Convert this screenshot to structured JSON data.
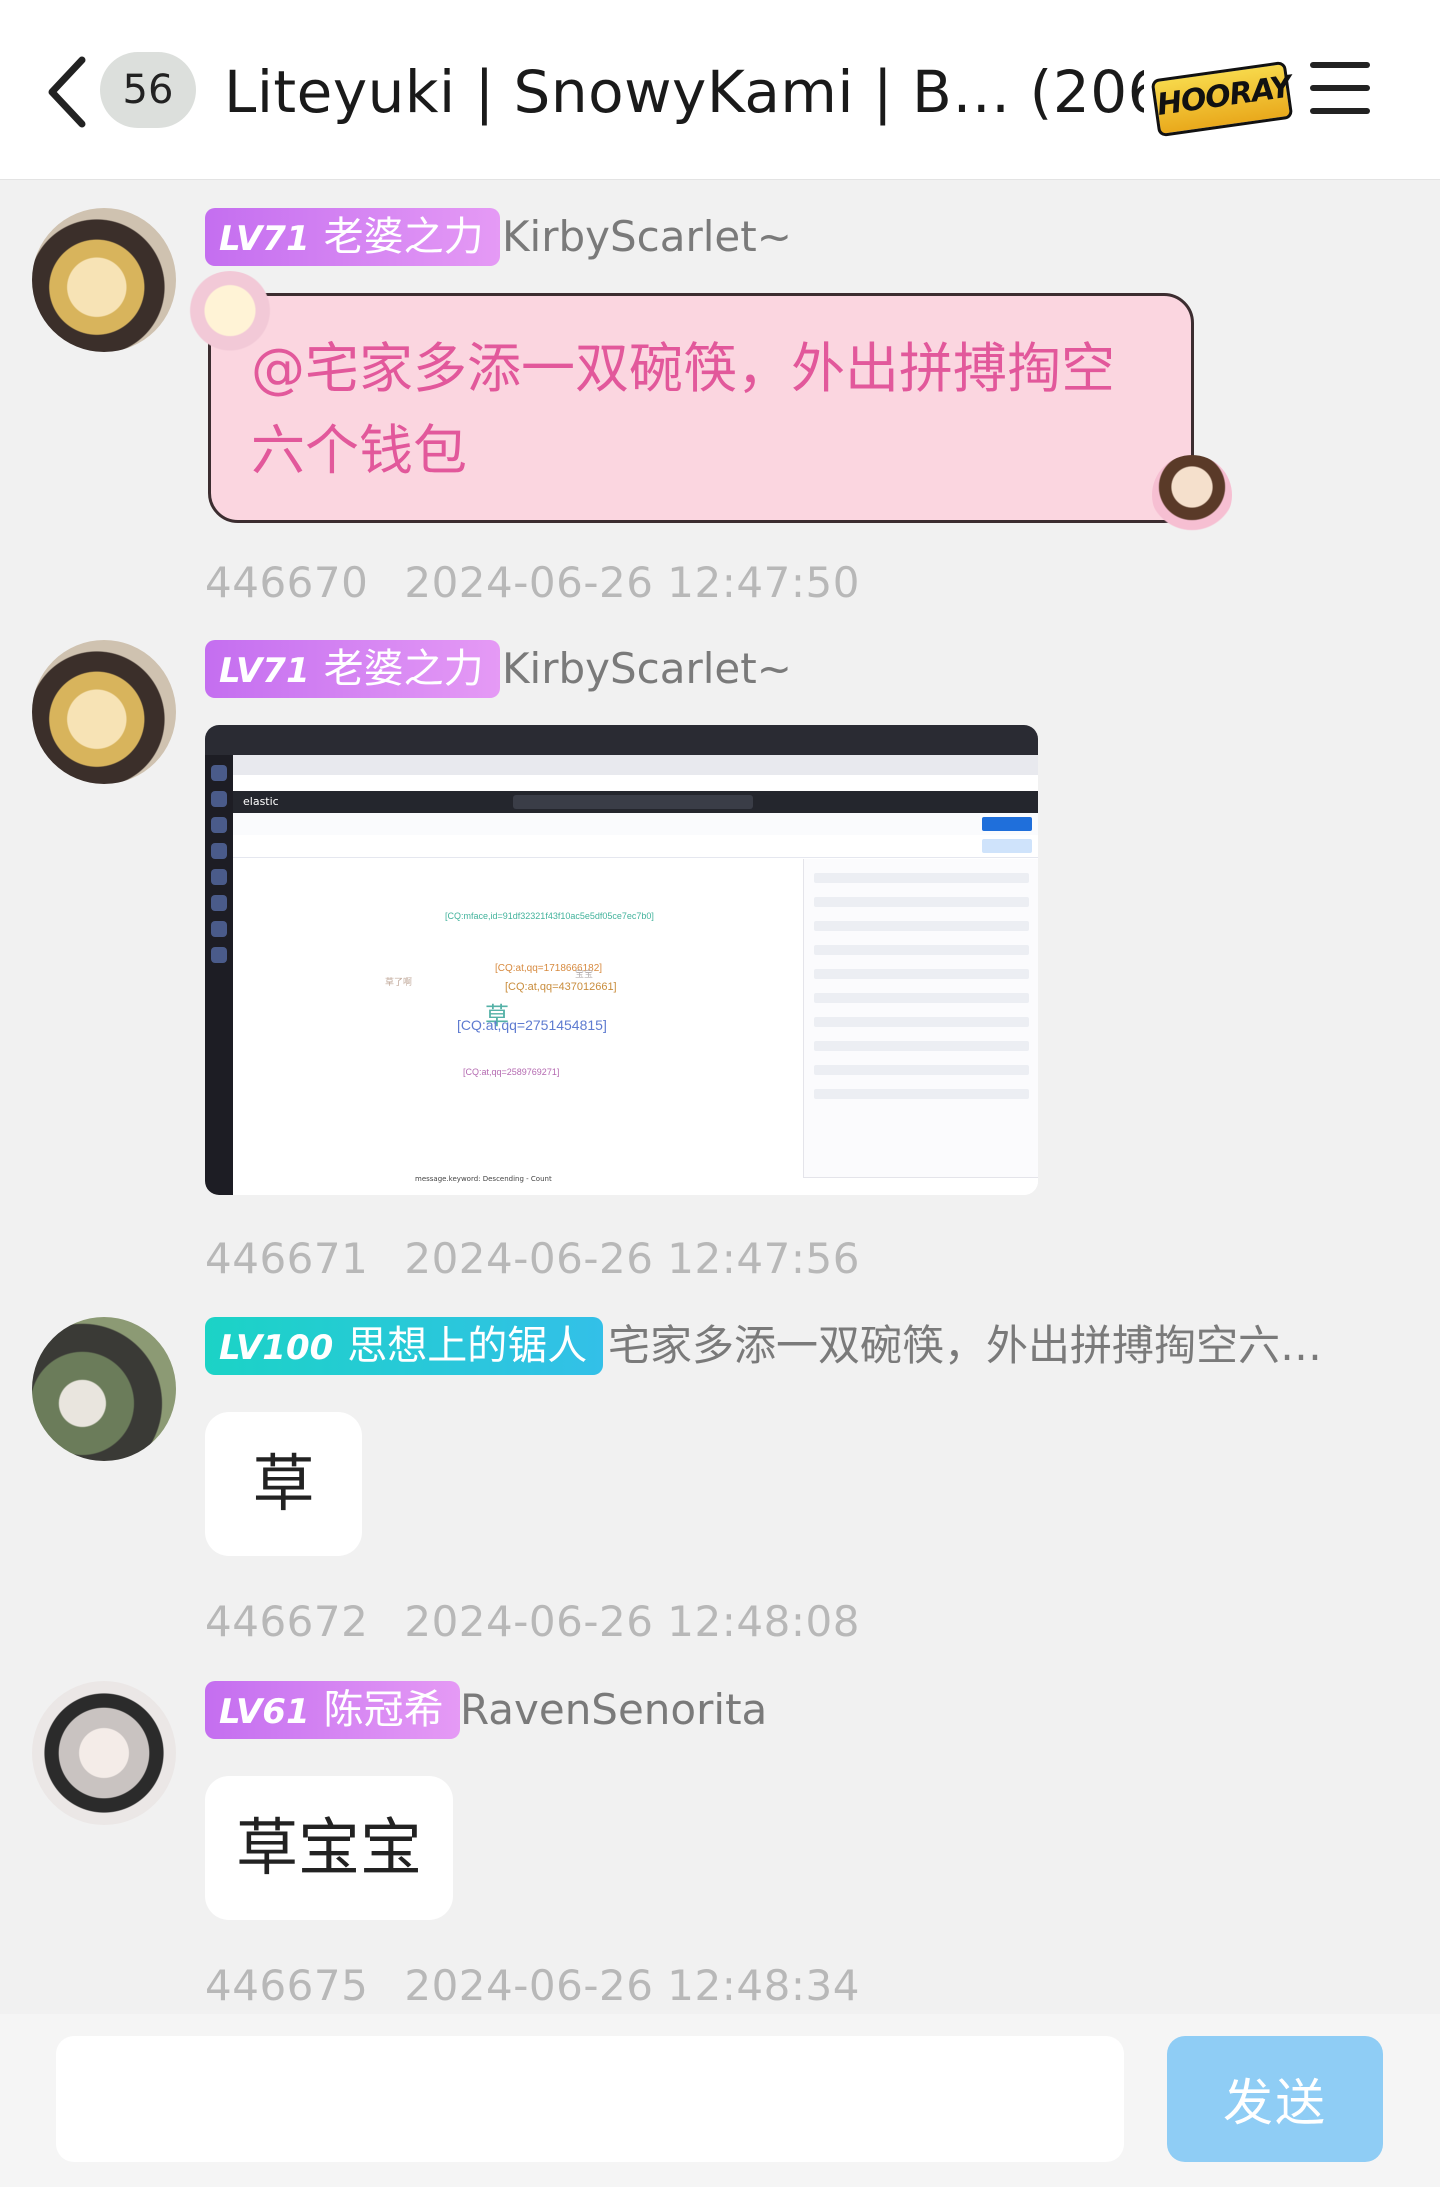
{
  "header": {
    "unread_count": "56",
    "title": "Liteyuki | SnowyKami | B… (206)",
    "badge_text": "HOORAY"
  },
  "messages": [
    {
      "level": "LV71",
      "title_badge": "老婆之力",
      "sender": "KirbyScarlet~",
      "text": "@宅家多添一双碗筷，外出拼搏掏空六个钱包",
      "id": "446670",
      "time": "2024-06-26 12:47:50"
    },
    {
      "level": "LV71",
      "title_badge": "老婆之力",
      "sender": "KirbyScarlet~",
      "image": {
        "brand": "elastic",
        "words": [
          "[CQ:mface,id=91df32321f43f10ac5e5df05ce7ec7b0]",
          "[CQ:at,qq=1718666182]",
          "[CQ:at,qq=437012661]",
          "草",
          "[CQ:at,qq=2751454815]",
          "[CQ:at,qq=2589769271]",
          "宝宝",
          "草了啊"
        ],
        "caption": "message.keyword: Descending - Count"
      },
      "id": "446671",
      "time": "2024-06-26 12:47:56"
    },
    {
      "level": "LV100",
      "title_badge": "思想上的锯人",
      "sender": "宅家多添一双碗筷，外出拼搏掏空六…",
      "text": "草",
      "id": "446672",
      "time": "2024-06-26 12:48:08"
    },
    {
      "level": "LV61",
      "title_badge": "陈冠希",
      "sender": "RavenSenorita",
      "text": "草宝宝",
      "id": "446675",
      "time": "2024-06-26 12:48:34"
    }
  ],
  "composer": {
    "value": "",
    "send_label": "发送"
  }
}
